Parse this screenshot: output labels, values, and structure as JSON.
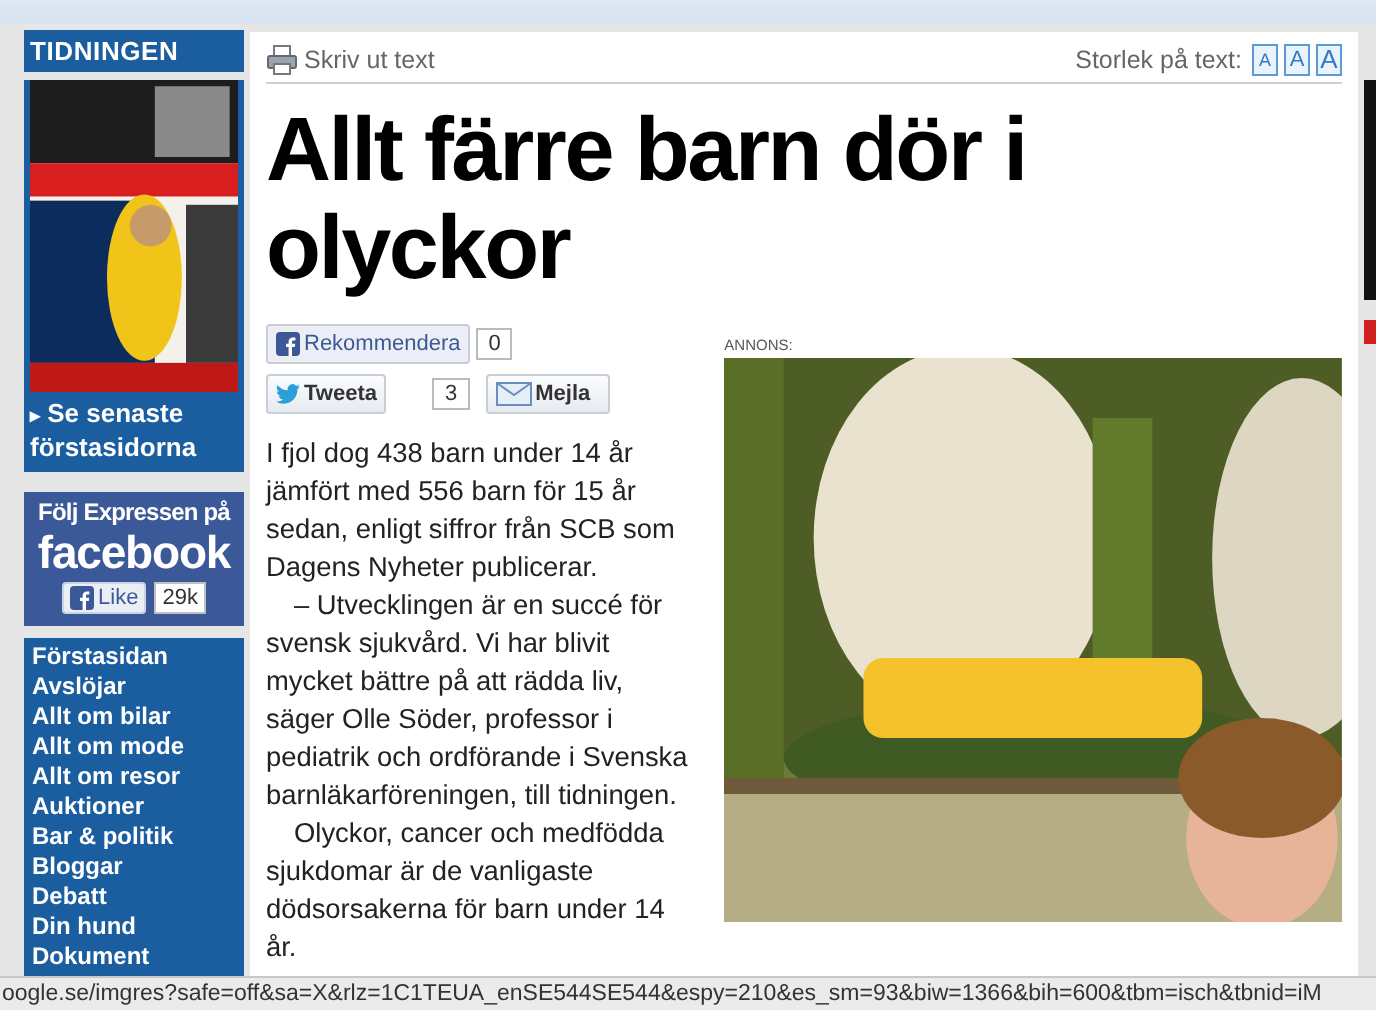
{
  "sidebar": {
    "header": "TIDNINGEN",
    "latest_link": {
      "arrow": "▸",
      "label": "Se senaste förstasidorna"
    },
    "facebook_box": {
      "title": "Följ Expressen på",
      "brand": "facebook",
      "like_label": "Like",
      "like_count": "29k"
    },
    "nav": [
      "Förstasidan",
      "Avslöjar",
      "Allt om bilar",
      "Allt om mode",
      "Allt om resor",
      "Auktioner",
      "Bar & politik",
      "Bloggar",
      "Debatt",
      "Din hund",
      "Dokument"
    ]
  },
  "toolbar": {
    "print_label": "Skriv ut text",
    "size_label": "Storlek på text:",
    "size_buttons": [
      "A",
      "A",
      "A"
    ]
  },
  "article": {
    "headline": "Allt färre barn dör i olyckor",
    "share": [
      {
        "kind": "facebook",
        "label": "Rekommendera",
        "count": "0"
      },
      {
        "kind": "twitter",
        "label": "Tweeta",
        "count": "3"
      },
      {
        "kind": "mail",
        "label": "Mejla"
      }
    ],
    "paragraphs": [
      "I fjol dog 438 barn under 14 år jämfört med 556 barn för 15 år sedan, enligt siffror från SCB som Dagens Nyheter publicerar.",
      "– Utvecklingen är en succé för svensk sjukvård. Vi har blivit mycket bättre på att rädda liv, säger Olle Söder, professor i pediatrik och ordförande i Svenska barnläkarföreningen, till tidningen.",
      "Olyckor, cancer och medfödda sjukdomar är de vanligaste dödsorsakerna för barn under 14 år."
    ],
    "ad": {
      "label": "ANNONS:",
      "kind": "picture"
    }
  },
  "status_bar": "oogle.se/imgres?safe=off&sa=X&rlz=1C1TEUA_enSE544SE544&espy=210&es_sm=93&biw=1366&bih=600&tbm=isch&tbnid=iM"
}
